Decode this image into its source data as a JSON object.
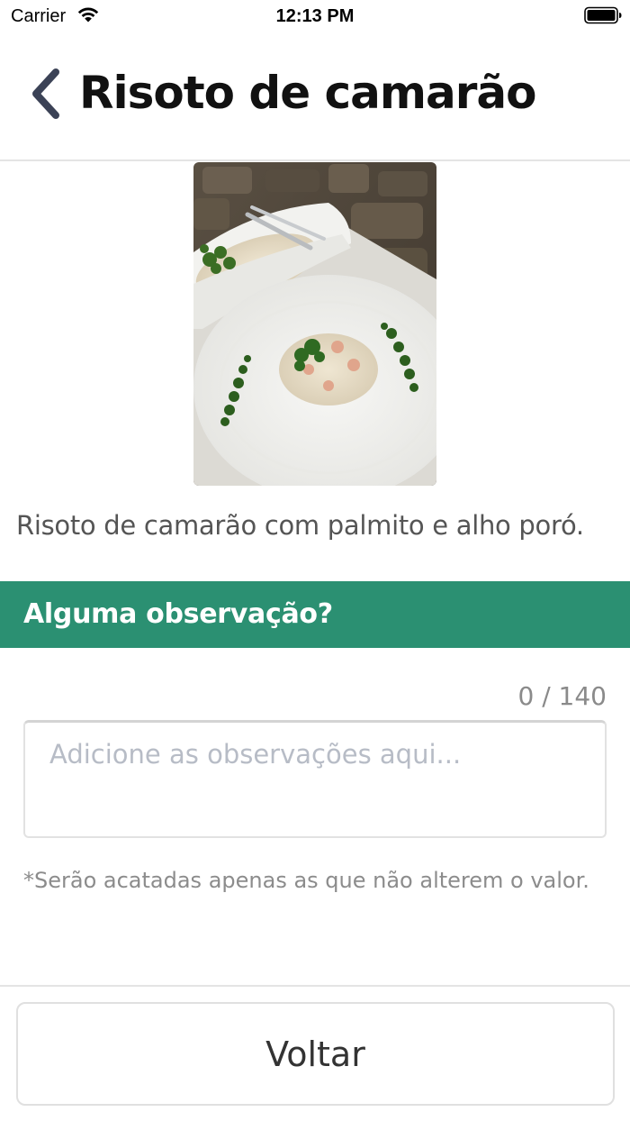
{
  "status_bar": {
    "carrier": "Carrier",
    "time": "12:13 PM",
    "icons": [
      "wifi-icon",
      "battery-icon"
    ]
  },
  "header": {
    "title": "Risoto de camarão",
    "back_icon": "chevron-left-icon"
  },
  "item": {
    "image_description": "photo",
    "description": "Risoto de camarão com palmito e alho poró."
  },
  "observations": {
    "section_title": "Alguma observação?",
    "counter": "0 / 140",
    "value": "",
    "placeholder": "Adicione as observações aqui...",
    "hint": "*Serão acatadas apenas as que não alterem o valor."
  },
  "footer": {
    "back_button_label": "Voltar"
  },
  "colors": {
    "accent": "#2b9072",
    "back_chevron": "#3b4256"
  }
}
